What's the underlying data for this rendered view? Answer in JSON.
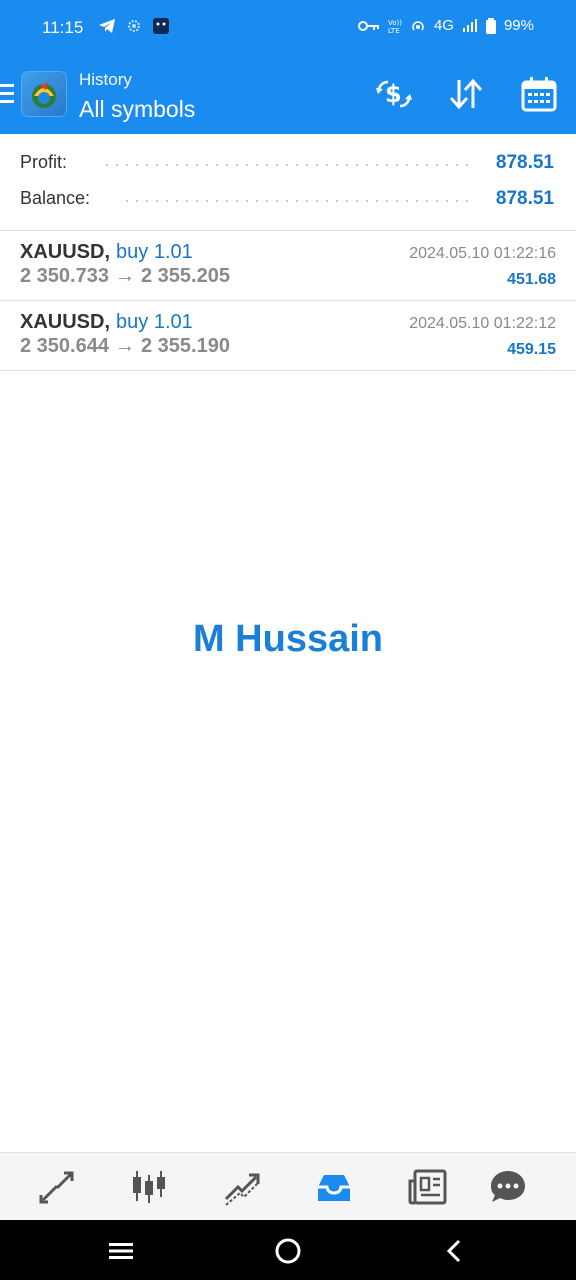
{
  "status_bar": {
    "time": "11:15",
    "battery": "99%",
    "network": "4G"
  },
  "header": {
    "subtitle": "History",
    "title": "All symbols",
    "icons": [
      "menu-icon",
      "app-logo-icon",
      "currency-exchange-icon",
      "sort-icon",
      "calendar-icon"
    ]
  },
  "summary": {
    "profit_label": "Profit:",
    "profit_value": "878.51",
    "balance_label": "Balance:",
    "balance_value": "878.51"
  },
  "trades": [
    {
      "symbol": "XAUUSD,",
      "side": "buy 1.01",
      "open_price": "2 350.733",
      "arrow": "→",
      "close_price": "2 355.205",
      "time": "2024.05.10 01:22:16",
      "profit": "451.68"
    },
    {
      "symbol": "XAUUSD,",
      "side": "buy 1.01",
      "open_price": "2 350.644",
      "arrow": "→",
      "close_price": "2 355.190",
      "time": "2024.05.10 01:22:12",
      "profit": "459.15"
    }
  ],
  "watermark": "M Hussain",
  "bottom_tabs": {
    "items": [
      "quotes-icon",
      "chart-icon",
      "trade-icon",
      "history-icon",
      "news-icon",
      "messages-icon"
    ],
    "active": "history-icon"
  },
  "colors": {
    "accent": "#1a8cf0",
    "value_blue": "#1976c9",
    "muted": "#8a8a8a"
  }
}
